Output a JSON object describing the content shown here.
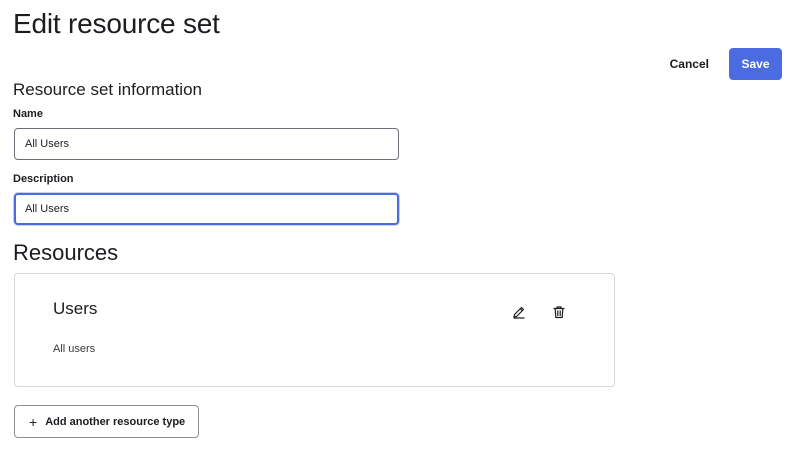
{
  "page": {
    "title": "Edit resource set"
  },
  "actions": {
    "cancel_label": "Cancel",
    "save_label": "Save"
  },
  "info_section": {
    "heading": "Resource set information",
    "name_label": "Name",
    "name_value": "All Users",
    "description_label": "Description",
    "description_value": "All Users"
  },
  "resources_section": {
    "heading": "Resources",
    "items": [
      {
        "title": "Users",
        "description": "All users",
        "edit_icon": "pencil-icon",
        "delete_icon": "trash-icon"
      }
    ],
    "add_label": "Add another resource type",
    "add_icon": "+"
  },
  "colors": {
    "primary": "#4b6be0",
    "text": "#1d1d21",
    "border": "#d7d7dc"
  }
}
